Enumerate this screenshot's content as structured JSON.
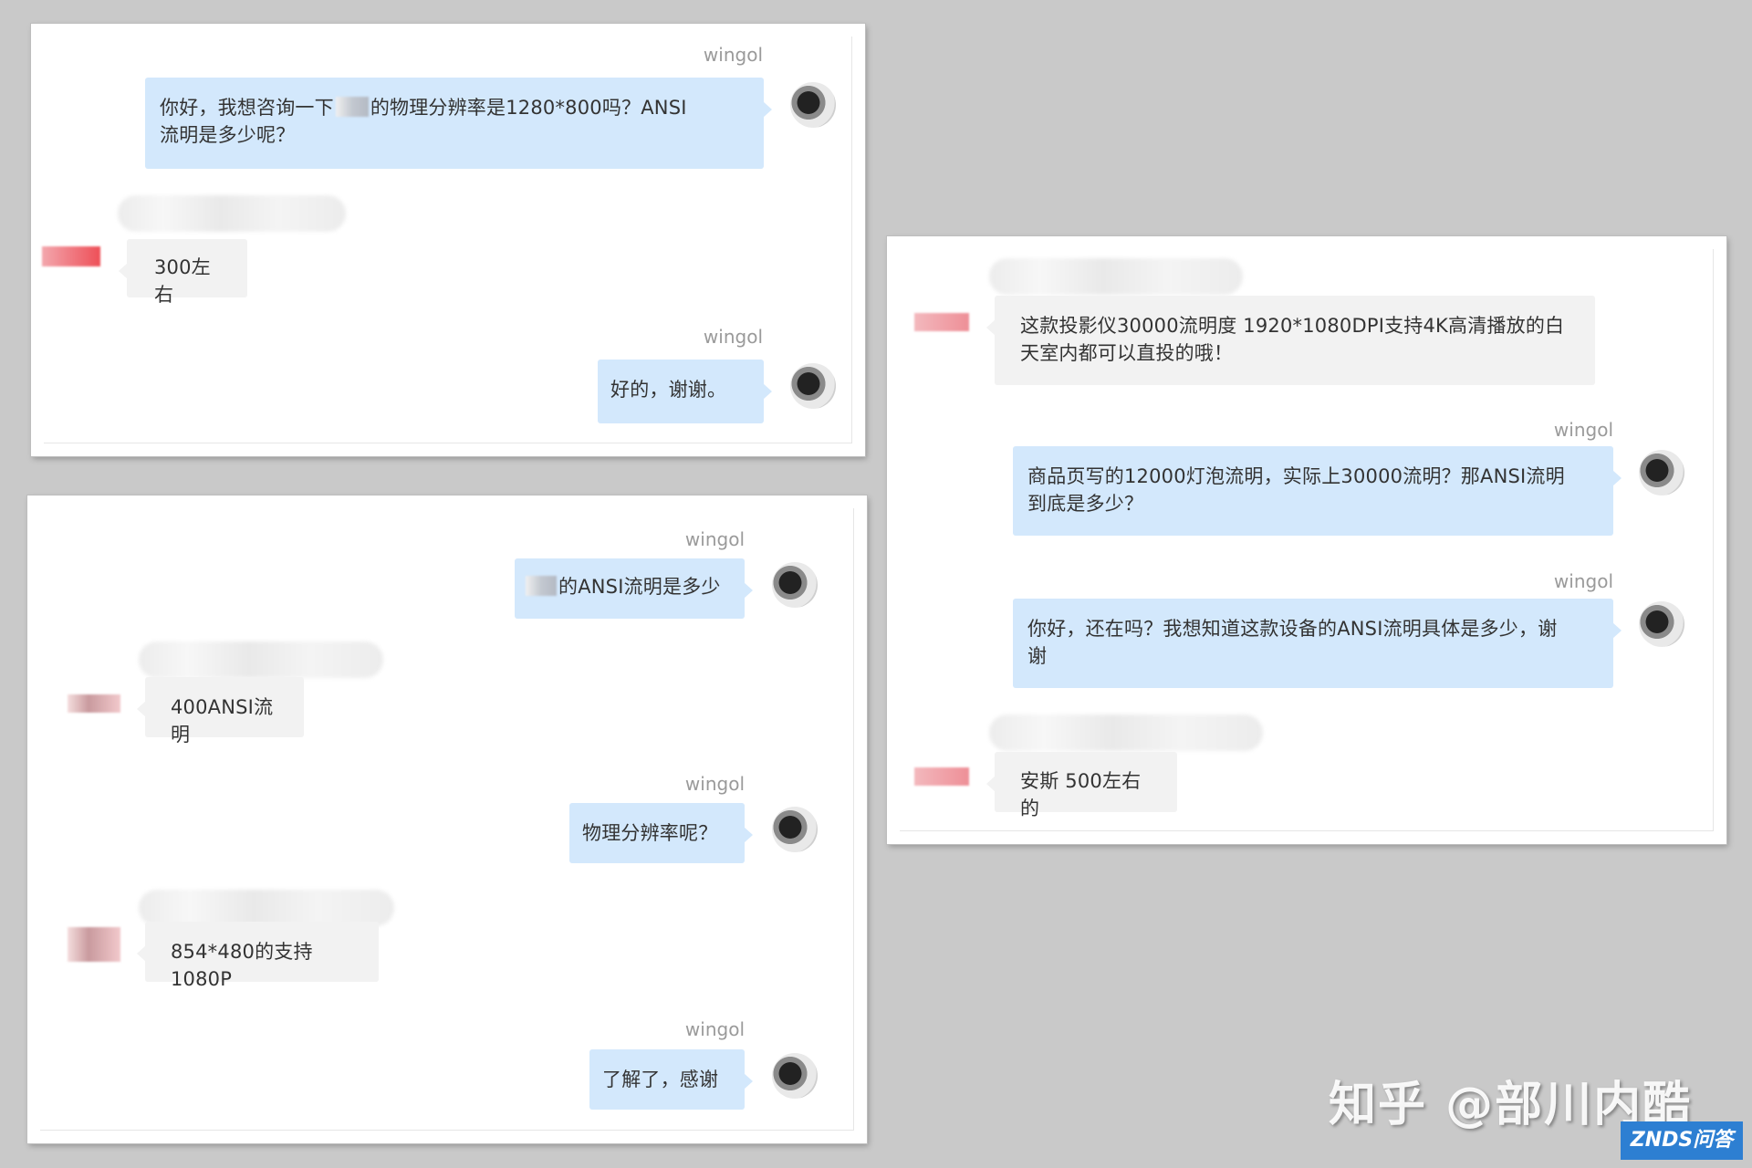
{
  "panel1": {
    "m1": {
      "sender": "wingol",
      "text_a": "你好，我想咨询一下",
      "text_b": "的物理分辨率是1280*800吗？ANSI",
      "text_c": "流明是多少呢？"
    },
    "r1": {
      "text": "300左右"
    },
    "m2": {
      "sender": "wingol",
      "text": "好的，谢谢。"
    }
  },
  "panel2": {
    "m1": {
      "sender": "wingol",
      "text": "的ANSI流明是多少"
    },
    "r1": {
      "text": "400ANSI流明"
    },
    "m2": {
      "sender": "wingol",
      "text": "物理分辨率呢？"
    },
    "r2": {
      "text": "854*480的支持1080P"
    },
    "m3": {
      "sender": "wingol",
      "text": "了解了，感谢"
    }
  },
  "panel3": {
    "r1": {
      "line1": "这款投影仪30000流明度 1920*1080DPI支持4K高清播放的白",
      "line2": "天室内都可以直投的哦！"
    },
    "m1": {
      "sender": "wingol",
      "line1": "商品页写的12000灯泡流明，实际上30000流明？那ANSI流明",
      "line2": "到底是多少？"
    },
    "m2": {
      "sender": "wingol",
      "line1": "你好，还在吗？我想知道这款设备的ANSI流明具体是多少，谢",
      "line2": "谢"
    },
    "r2": {
      "text": "安斯 500左右的"
    }
  },
  "watermark": {
    "text": "知乎 @部川内酷"
  },
  "logo": {
    "text": "ZNDS问答"
  }
}
